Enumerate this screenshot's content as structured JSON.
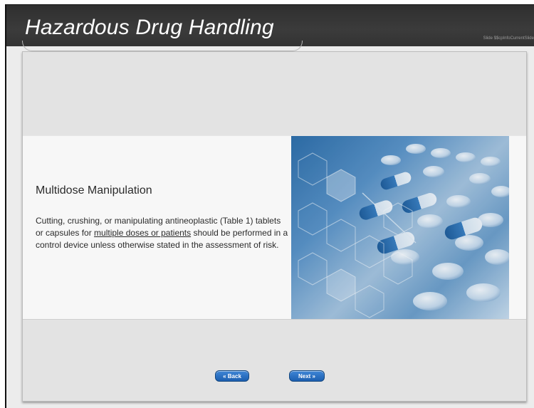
{
  "header": {
    "title": "Hazardous Drug Handling",
    "slide_info": "Slide $$cpInfoCurrentSlide"
  },
  "content": {
    "heading": "Multidose Manipulation",
    "body_before": "Cutting, crushing, or manipulating antineoplastic (Table 1) tablets or capsules for ",
    "body_link": "multiple doses or patients",
    "body_after": " should be performed in a control device unless otherwise stated in the assessment of risk.",
    "image_icon": "pills-and-capsules-photo"
  },
  "nav": {
    "back_label": "« Back",
    "next_label": "Next »"
  },
  "colors": {
    "header_bg": "#333333",
    "button_blue": "#2a70c4",
    "panel_bg": "#e3e3e3"
  }
}
